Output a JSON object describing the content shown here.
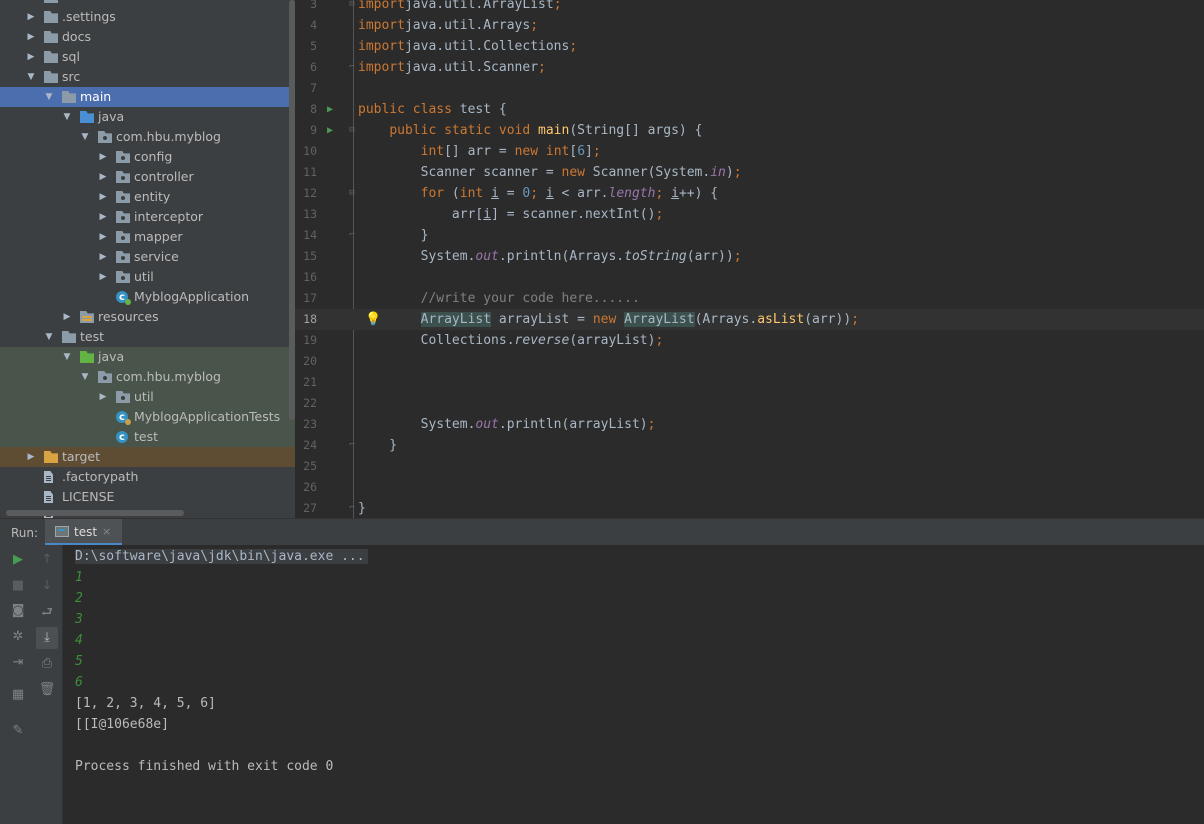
{
  "project_tree": {
    "items": [
      {
        "label": "",
        "depth": 1,
        "arrow": "▶",
        "icon": "folder-plain"
      },
      {
        "label": ".settings",
        "depth": 1,
        "arrow": "▶",
        "icon": "folder-plain"
      },
      {
        "label": "docs",
        "depth": 1,
        "arrow": "▶",
        "icon": "folder-plain"
      },
      {
        "label": "sql",
        "depth": 1,
        "arrow": "▶",
        "icon": "folder-plain"
      },
      {
        "label": "src",
        "depth": 1,
        "arrow": "▼",
        "icon": "folder-plain"
      },
      {
        "label": "main",
        "depth": 2,
        "arrow": "▼",
        "icon": "folder-plain",
        "state": "selected"
      },
      {
        "label": "java",
        "depth": 3,
        "arrow": "▼",
        "icon": "folder-blue"
      },
      {
        "label": "com.hbu.myblog",
        "depth": 4,
        "arrow": "▼",
        "icon": "package"
      },
      {
        "label": "config",
        "depth": 5,
        "arrow": "▶",
        "icon": "package"
      },
      {
        "label": "controller",
        "depth": 5,
        "arrow": "▶",
        "icon": "package"
      },
      {
        "label": "entity",
        "depth": 5,
        "arrow": "▶",
        "icon": "package"
      },
      {
        "label": "interceptor",
        "depth": 5,
        "arrow": "▶",
        "icon": "package"
      },
      {
        "label": "mapper",
        "depth": 5,
        "arrow": "▶",
        "icon": "package"
      },
      {
        "label": "service",
        "depth": 5,
        "arrow": "▶",
        "icon": "package"
      },
      {
        "label": "util",
        "depth": 5,
        "arrow": "▶",
        "icon": "package"
      },
      {
        "label": "MyblogApplication",
        "depth": 5,
        "arrow": "",
        "icon": "class-spring"
      },
      {
        "label": "resources",
        "depth": 3,
        "arrow": "▶",
        "icon": "folder-resources"
      },
      {
        "label": "test",
        "depth": 2,
        "arrow": "▼",
        "icon": "folder-plain"
      },
      {
        "label": "java",
        "depth": 3,
        "arrow": "▼",
        "icon": "folder-green",
        "state": "test"
      },
      {
        "label": "com.hbu.myblog",
        "depth": 4,
        "arrow": "▼",
        "icon": "package",
        "state": "test"
      },
      {
        "label": "util",
        "depth": 5,
        "arrow": "▶",
        "icon": "package",
        "state": "test"
      },
      {
        "label": "MyblogApplicationTests",
        "depth": 5,
        "arrow": "",
        "icon": "class-test",
        "state": "test"
      },
      {
        "label": "test",
        "depth": 5,
        "arrow": "",
        "icon": "class",
        "state": "test"
      },
      {
        "label": "target",
        "depth": 1,
        "arrow": "▶",
        "icon": "folder-orange",
        "state": "excluded"
      },
      {
        "label": ".factorypath",
        "depth": 1,
        "arrow": "",
        "icon": "file"
      },
      {
        "label": "LICENSE",
        "depth": 1,
        "arrow": "",
        "icon": "file"
      },
      {
        "label": "",
        "depth": 1,
        "arrow": "",
        "icon": "file"
      }
    ]
  },
  "editor": {
    "current_line": 18,
    "lines": [
      {
        "n": "3",
        "tokens": [
          [
            "kw",
            "import"
          ],
          [
            "",
            "java.util.ArrayList"
          ],
          [
            "kw",
            ";"
          ]
        ]
      },
      {
        "n": "4",
        "tokens": [
          [
            "kw",
            "import"
          ],
          [
            "",
            "java.util.Arrays"
          ],
          [
            "kw",
            ";"
          ]
        ]
      },
      {
        "n": "5",
        "tokens": [
          [
            "kw",
            "import"
          ],
          [
            "",
            "java.util.Collections"
          ],
          [
            "kw",
            ";"
          ]
        ]
      },
      {
        "n": "6",
        "tokens": [
          [
            "kw",
            "import"
          ],
          [
            "",
            "java.util.Scanner"
          ],
          [
            "kw",
            ";"
          ]
        ]
      },
      {
        "n": "7",
        "tokens": []
      },
      {
        "n": "8",
        "tokens": [
          [
            "kw",
            "public class"
          ],
          [
            "",
            " test {"
          ]
        ]
      },
      {
        "n": "9",
        "tokens": [
          [
            "",
            "    "
          ],
          [
            "kw",
            "public static void"
          ],
          [
            "",
            " "
          ],
          [
            "fn",
            "main"
          ],
          [
            "",
            "(String[] args) {"
          ]
        ]
      },
      {
        "n": "10",
        "tokens": [
          [
            "",
            "        "
          ],
          [
            "kw",
            "int"
          ],
          [
            "",
            "[] arr = "
          ],
          [
            "kw",
            "new int"
          ],
          [
            "",
            "["
          ],
          [
            "num",
            "6"
          ],
          [
            "",
            "]"
          ],
          [
            "kw",
            ";"
          ]
        ]
      },
      {
        "n": "11",
        "tokens": [
          [
            "",
            "        Scanner scanner = "
          ],
          [
            "kw",
            "new"
          ],
          [
            "",
            " Scanner(System."
          ],
          [
            "sf",
            "in"
          ],
          [
            "",
            ")"
          ],
          [
            "kw",
            ";"
          ]
        ]
      },
      {
        "n": "12",
        "tokens": [
          [
            "",
            "        "
          ],
          [
            "kw",
            "for"
          ],
          [
            "",
            " ("
          ],
          [
            "kw",
            "int"
          ],
          [
            "",
            " "
          ],
          [
            "ul",
            "i"
          ],
          [
            "",
            " = "
          ],
          [
            "num",
            "0"
          ],
          [
            "kw",
            ";"
          ],
          [
            "",
            " "
          ],
          [
            "ul",
            "i"
          ],
          [
            "",
            " < arr."
          ],
          [
            "sf",
            "length"
          ],
          [
            "kw",
            ";"
          ],
          [
            "",
            " "
          ],
          [
            "ul",
            "i"
          ],
          [
            "",
            "++) {"
          ]
        ]
      },
      {
        "n": "13",
        "tokens": [
          [
            "",
            "            arr["
          ],
          [
            "ul",
            "i"
          ],
          [
            "",
            "] = scanner.nextInt()"
          ],
          [
            "kw",
            ";"
          ]
        ]
      },
      {
        "n": "14",
        "tokens": [
          [
            "",
            "        }"
          ]
        ]
      },
      {
        "n": "15",
        "tokens": [
          [
            "",
            "        System."
          ],
          [
            "sf",
            "out"
          ],
          [
            "",
            ".println(Arrays."
          ],
          [
            "it",
            "toString"
          ],
          [
            "",
            "(arr))"
          ],
          [
            "kw",
            ";"
          ]
        ]
      },
      {
        "n": "16",
        "tokens": []
      },
      {
        "n": "17",
        "tokens": [
          [
            "",
            "        "
          ],
          [
            "cm",
            "//write your code here......"
          ]
        ]
      },
      {
        "n": "18",
        "tokens": [
          [
            "",
            "        "
          ],
          [
            "hl",
            "ArrayList"
          ],
          [
            "",
            " arrayList = "
          ],
          [
            "kw",
            "new"
          ],
          [
            "",
            " "
          ],
          [
            "hl",
            "ArrayList"
          ],
          [
            "",
            "(Arrays."
          ],
          [
            "sm",
            "asList"
          ],
          [
            "",
            "(arr))"
          ],
          [
            "kw",
            ";"
          ]
        ]
      },
      {
        "n": "19",
        "tokens": [
          [
            "",
            "        Collections."
          ],
          [
            "it",
            "reverse"
          ],
          [
            "",
            "(arrayList)"
          ],
          [
            "kw",
            ";"
          ]
        ]
      },
      {
        "n": "20",
        "tokens": []
      },
      {
        "n": "21",
        "tokens": []
      },
      {
        "n": "22",
        "tokens": []
      },
      {
        "n": "23",
        "tokens": [
          [
            "",
            "        System."
          ],
          [
            "sf",
            "out"
          ],
          [
            "",
            ".println(arrayList)"
          ],
          [
            "kw",
            ";"
          ]
        ]
      },
      {
        "n": "24",
        "tokens": [
          [
            "",
            "    }"
          ]
        ]
      },
      {
        "n": "25",
        "tokens": []
      },
      {
        "n": "26",
        "tokens": []
      },
      {
        "n": "27",
        "tokens": [
          [
            "",
            "}"
          ]
        ]
      }
    ],
    "run_gutter_lines": [
      "8",
      "9"
    ],
    "fold_open_lines": [
      "3",
      "9",
      "12"
    ],
    "fold_close_lines": [
      "6",
      "14",
      "24",
      "27"
    ],
    "bulb_line": "18"
  },
  "overlay_caption": "",
  "run_panel": {
    "label": "Run:",
    "tab_label": "test",
    "tab_close": "×"
  },
  "console": {
    "command": "D:\\software\\java\\jdk\\bin\\java.exe ...",
    "inputs": [
      "1",
      "2",
      "3",
      "4",
      "5",
      "6"
    ],
    "outputs": [
      "[1, 2, 3, 4, 5, 6]",
      "[[I@106e68e]"
    ],
    "exit_message": "Process finished with exit code 0"
  },
  "colors": {
    "keyword": "#cc7832",
    "number": "#6897bb",
    "comment": "#808080",
    "method_decl": "#ffc66d",
    "static_field": "#9876aa",
    "selection": "#4b6eaf",
    "test_source_bg": "#49544a",
    "excluded_bg": "#5e4d33",
    "console_input": "#3c8d3c"
  }
}
